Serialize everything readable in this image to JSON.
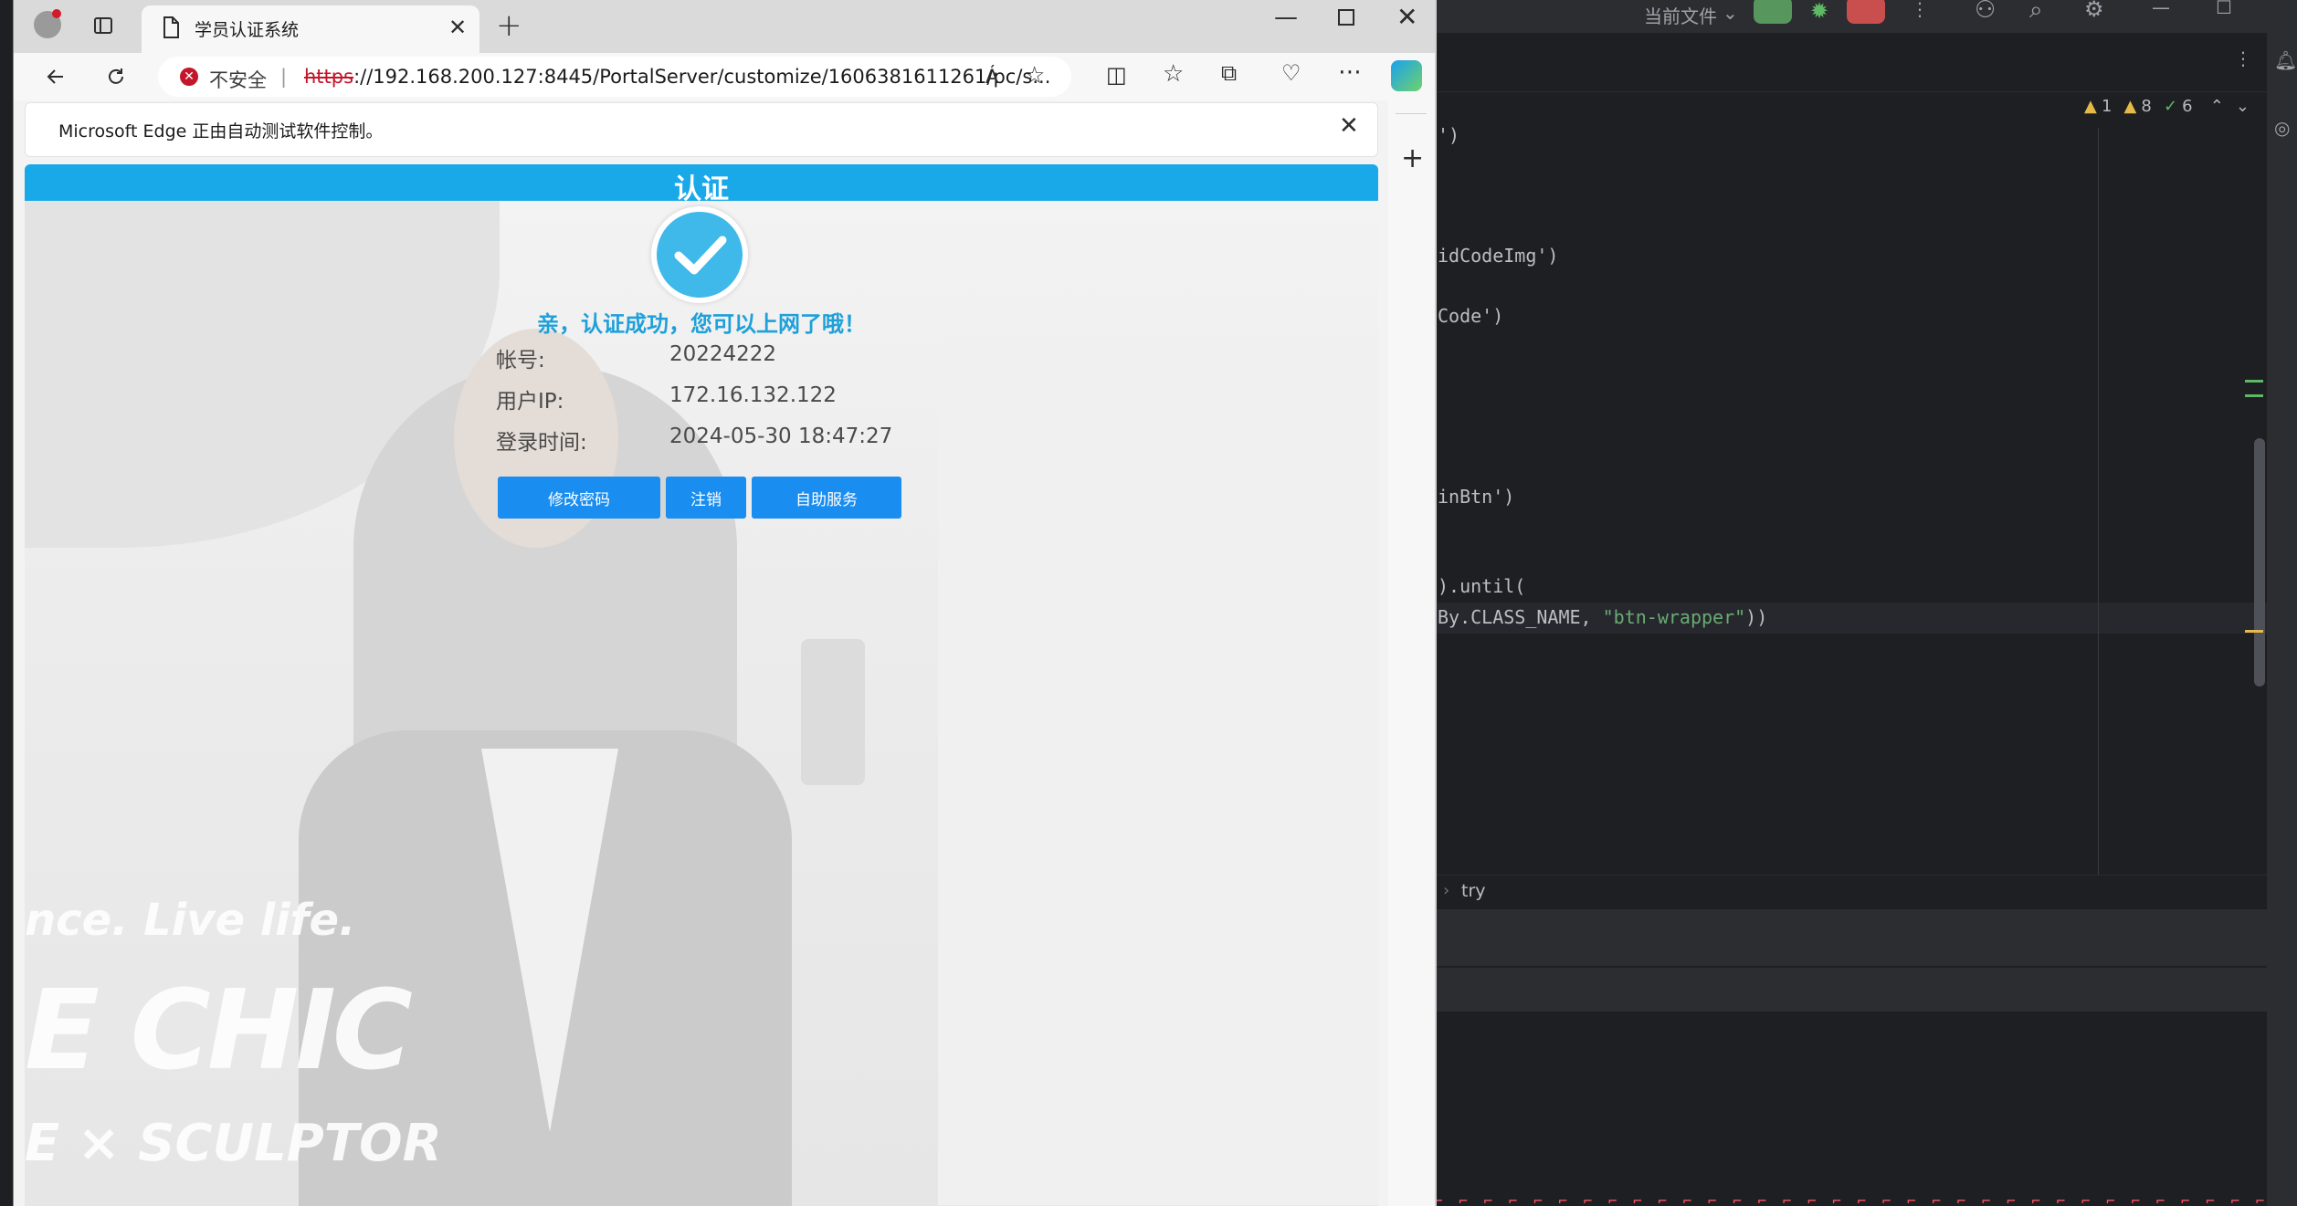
{
  "browser": {
    "tab_title": "学员认证系统",
    "security_label": "不安全",
    "url_scheme": "https",
    "url_rest": "://192.168.200.127:8445/PortalServer/customize/1606381611261/pc/s...",
    "read_aloud_label": "Á",
    "infobar_text": "Microsoft Edge 正由自动测试软件控制。"
  },
  "portal": {
    "header_title": "认证",
    "success_message": "亲，认证成功，您可以上网了哦！",
    "fields": [
      {
        "label": "帐号:",
        "value": "20224222"
      },
      {
        "label": "用户IP:",
        "value": "172.16.132.122"
      },
      {
        "label": "登录时间:",
        "value": "2024-05-30 18:47:27"
      }
    ],
    "buttons": {
      "change_password": "修改密码",
      "logout": "注销",
      "self_service": "自助服务"
    },
    "bg_watermarks": [
      "nce. Live life.",
      "E CHIC",
      "E × SCULPTOR"
    ]
  },
  "ide": {
    "top_label": "当前文件",
    "inspection_counts": {
      "warnings": "1",
      "weak_warnings": "8",
      "ok": "6"
    },
    "code_lines": [
      {
        "text": "')"
      },
      {
        "text": "idCodeImg')"
      },
      {
        "text": "Code')"
      },
      {
        "text": "inBtn')"
      },
      {
        "text": ").until("
      },
      {
        "pre": "By.CLASS_NAME, ",
        "str": "\"btn-wrapper\"",
        "post": "))"
      }
    ],
    "breadcrumb": "try"
  },
  "colors": {
    "portal_header": "#1aa9e8",
    "portal_button": "#1a8df0",
    "success_text": "#1fa0d9",
    "ide_bg": "#1e1f22",
    "ide_string": "#6aab73"
  }
}
